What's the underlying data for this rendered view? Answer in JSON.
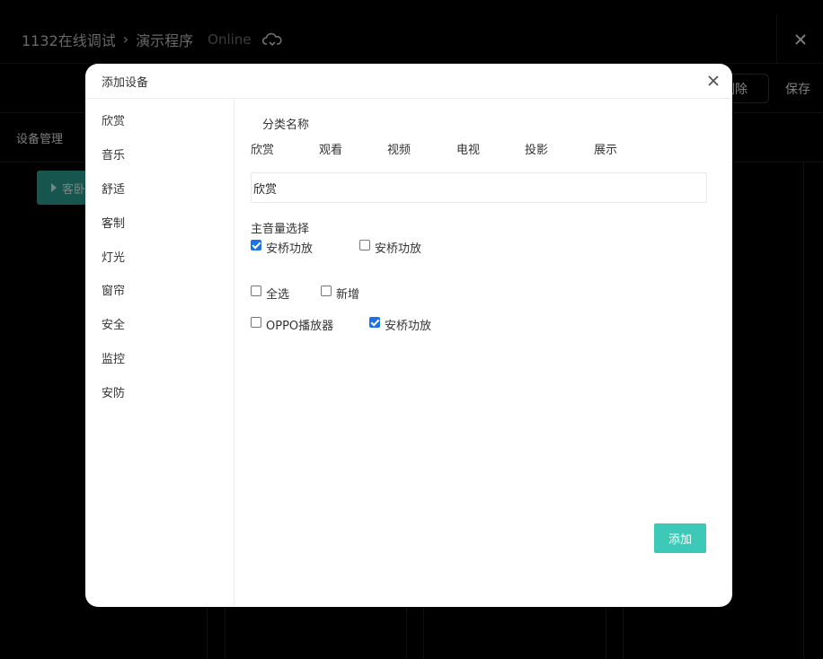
{
  "app": {
    "project": "1132在线调试",
    "program": "演示程序",
    "status": "Online",
    "cloud_icon": "cloud-sync-icon",
    "close_icon": "close-icon"
  },
  "toolbar": {
    "delete_label": "删除",
    "save_label": "保存"
  },
  "tabs": {
    "device_management": "设备管理"
  },
  "room_chip": {
    "label": "客卧"
  },
  "modal": {
    "title": "添加设备",
    "close_icon": "close-icon",
    "sidebar": [
      "欣赏",
      "音乐",
      "舒适",
      "客制",
      "灯光",
      "窗帘",
      "安全",
      "监控",
      "安防"
    ],
    "category_label": "分类名称",
    "category_tabs": [
      "欣赏",
      "观看",
      "视频",
      "电视",
      "投影",
      "展示"
    ],
    "name_input_value": "欣赏",
    "main_volume_label": "主音量选择",
    "main_volume_options": [
      {
        "label": "安桥功放",
        "checked": true
      },
      {
        "label": "安桥功放",
        "checked": false
      }
    ],
    "select_all_label": "全选",
    "add_new_label": "新增",
    "device_options": [
      {
        "label": "OPPO播放器",
        "checked": false
      },
      {
        "label": "安桥功放",
        "checked": true
      }
    ],
    "add_button": "添加"
  },
  "colors": {
    "accent": "#3cc9b8",
    "checkbox": "#1a73e8",
    "chip": "#2a9d8f"
  }
}
